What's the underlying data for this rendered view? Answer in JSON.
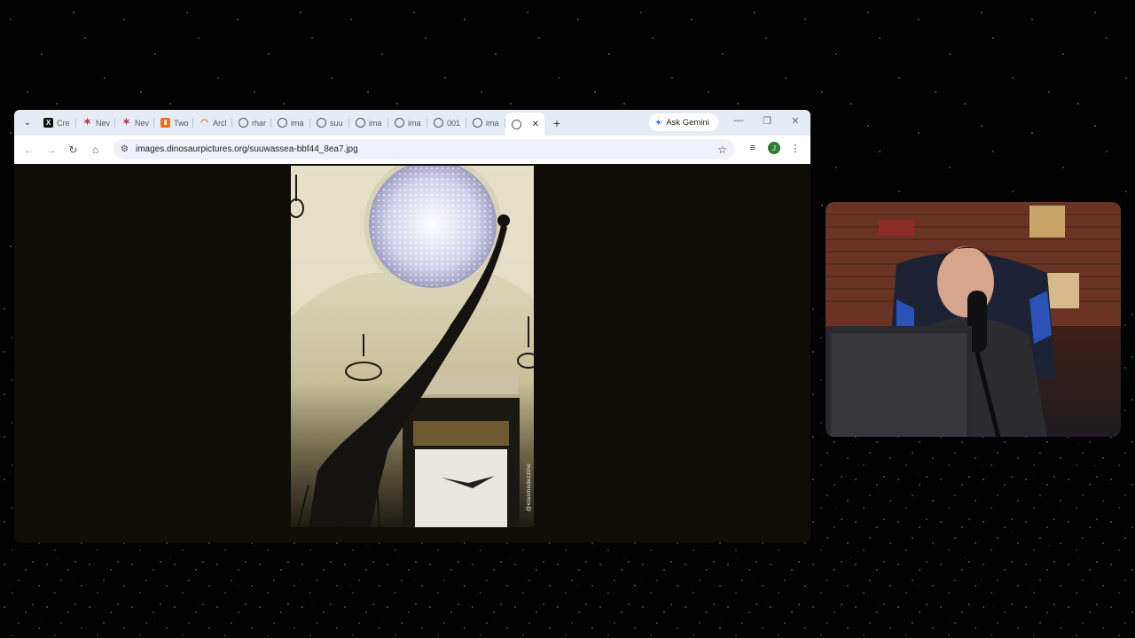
{
  "browser": {
    "tabs": [
      {
        "label": "Cre",
        "icon": "x-icon"
      },
      {
        "label": "Nev",
        "icon": "star-icon"
      },
      {
        "label": "Nev",
        "icon": "star-icon"
      },
      {
        "label": "Two",
        "icon": "orange-square-icon"
      },
      {
        "label": "Arcl",
        "icon": "arc-icon"
      },
      {
        "label": "rhar",
        "icon": "globe-icon"
      },
      {
        "label": "ima",
        "icon": "globe-icon"
      },
      {
        "label": "suu",
        "icon": "globe-icon"
      },
      {
        "label": "ima",
        "icon": "globe-icon"
      },
      {
        "label": "ima",
        "icon": "globe-icon"
      },
      {
        "label": "001",
        "icon": "globe-icon"
      },
      {
        "label": "ima",
        "icon": "globe-icon"
      }
    ],
    "active_tab": {
      "icon": "globe-icon",
      "close": "✕"
    },
    "new_tab": "+",
    "gemini_label": "Ask Gemini",
    "window_controls": {
      "minimize": "—",
      "restore": "❐",
      "close": "✕"
    },
    "url": "images.dinosaurpictures.org/suuwassea-bbf44_8ea7.jpg",
    "profile_initial": "J"
  },
  "image": {
    "watermark": "@elasmodezzine"
  }
}
